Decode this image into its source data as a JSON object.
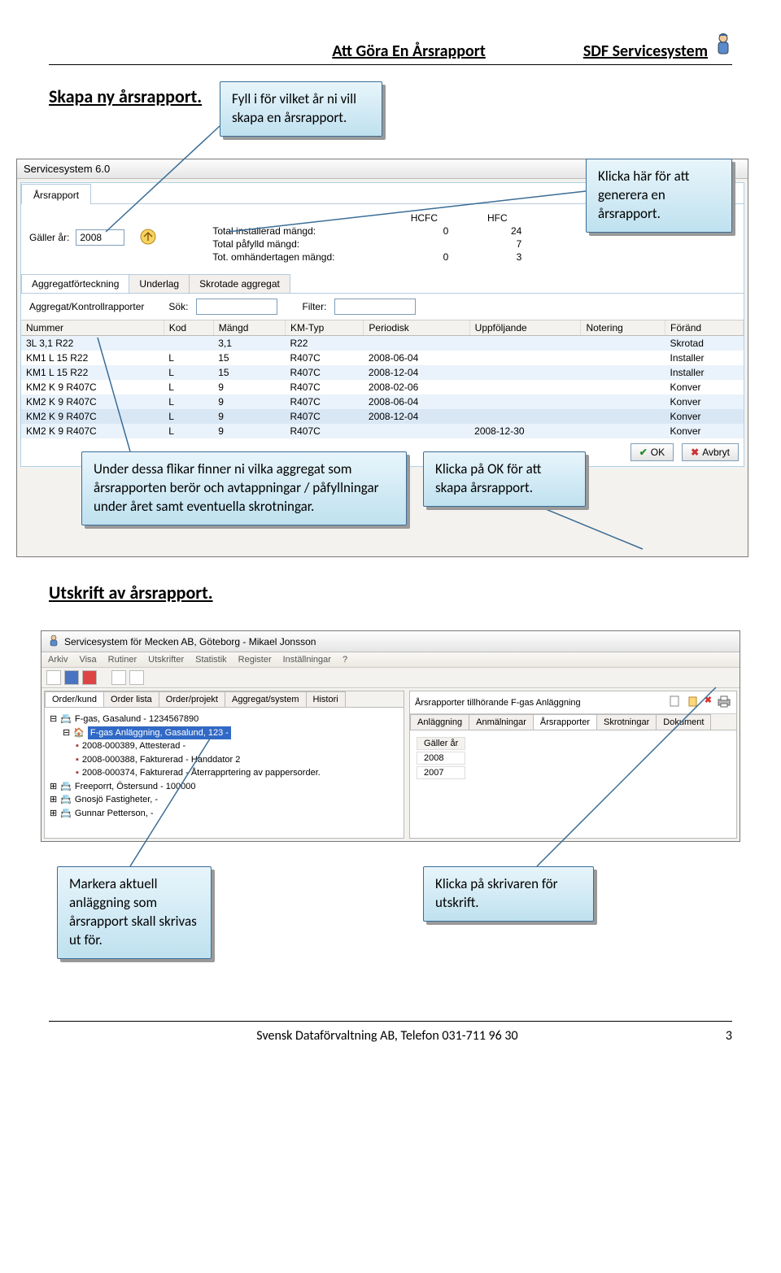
{
  "header": {
    "left": "Att Göra En Årsrapport",
    "right": "SDF Servicesystem"
  },
  "section1": {
    "title": "Skapa ny årsrapport.",
    "callout_fill": "Fyll i för vilket år ni vill skapa en årsrapport.",
    "callout_generate": "Klicka här för att generera en årsrapport.",
    "callout_tabs": "Under dessa flikar finner ni vilka aggregat som årsrapporten berör och avtappningar / påfyllningar under året samt eventuella skrotningar.",
    "callout_ok": "Klicka på OK för att skapa årsrapport.",
    "window_title": "Servicesystem 6.0",
    "tab_main": "Årsrapport",
    "year_label": "Gäller år:",
    "year_value": "2008",
    "stats": {
      "row_labels": [
        "Total installerad mängd:",
        "Total påfylld mängd:",
        "Tot. omhändertagen mängd:"
      ],
      "col_labels": [
        "HCFC",
        "HFC"
      ],
      "rows": [
        [
          "0",
          "24"
        ],
        [
          "",
          "7"
        ],
        [
          "0",
          "3"
        ]
      ]
    },
    "subtabs": [
      "Aggregatförteckning",
      "Underlag",
      "Skrotade aggregat"
    ],
    "subtab_title": "Aggregat/Kontrollrapporter",
    "search_label": "Sök:",
    "filter_label": "Filter:",
    "grid": {
      "columns": [
        "Nummer",
        "Kod",
        "Mängd",
        "KM-Typ",
        "Periodisk",
        "Uppföljande",
        "Notering",
        "Föränd"
      ],
      "rows": [
        [
          "3L 3,1 R22",
          "",
          "3,1",
          "R22",
          "",
          "",
          "",
          "Skrotad"
        ],
        [
          "KM1 L 15 R22",
          "L",
          "15",
          "R407C",
          "2008-06-04",
          "",
          "",
          "Installer"
        ],
        [
          "KM1 L 15 R22",
          "L",
          "15",
          "R407C",
          "2008-12-04",
          "",
          "",
          "Installer"
        ],
        [
          "KM2 K 9 R407C",
          "L",
          "9",
          "R407C",
          "2008-02-06",
          "",
          "",
          "Konver"
        ],
        [
          "KM2 K 9 R407C",
          "L",
          "9",
          "R407C",
          "2008-06-04",
          "",
          "",
          "Konver"
        ],
        [
          "KM2 K 9 R407C",
          "L",
          "9",
          "R407C",
          "2008-12-04",
          "",
          "",
          "Konver"
        ],
        [
          "KM2 K 9 R407C",
          "L",
          "9",
          "R407C",
          "",
          "2008-12-30",
          "",
          "Konver"
        ]
      ]
    },
    "btn_ok": "OK",
    "btn_cancel": "Avbryt"
  },
  "section2": {
    "title": "Utskrift av årsrapport.",
    "callout_mark": "Markera aktuell anläggning som årsrapport skall skrivas ut för.",
    "callout_print": "Klicka på skrivaren för utskrift.",
    "window_title": "Servicesystem för Mecken AB, Göteborg - Mikael Jonsson",
    "menus": [
      "Arkiv",
      "Visa",
      "Rutiner",
      "Utskrifter",
      "Statistik",
      "Register",
      "Inställningar",
      "?"
    ],
    "left_tabs": [
      "Order/kund",
      "Order lista",
      "Order/projekt",
      "Aggregat/system",
      "Histori"
    ],
    "right_header": "Årsrapporter tillhörande F-gas Anläggning",
    "right_tabs": [
      "Anläggning",
      "Anmälningar",
      "Årsrapporter",
      "Skrotningar",
      "Dokument"
    ],
    "tree": {
      "root": "F-gas, Gasalund - 1234567890",
      "sel": "F-gas Anläggning, Gasalund, 123 -",
      "items": [
        "2008-000389, Attesterad -",
        "2008-000388, Fakturerad - Handdator 2",
        "2008-000374, Fakturerad - Återrapprtering av pappersorder."
      ],
      "siblings": [
        "Freeporrt, Östersund - 100000",
        "Gnosjö Fastigheter, -",
        "Gunnar Petterson, -"
      ]
    },
    "mini_grid": {
      "header": "Gäller år",
      "rows": [
        "2008",
        "2007"
      ]
    }
  },
  "footer": {
    "center": "Svensk Dataförvaltning AB, Telefon 031-711 96 30",
    "page": "3"
  }
}
